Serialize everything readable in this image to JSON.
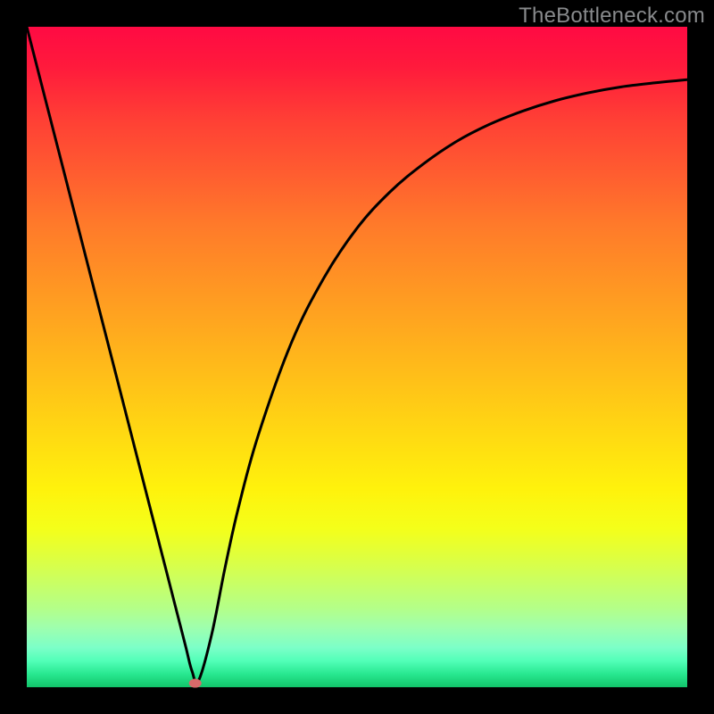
{
  "watermark": {
    "text": "TheBottleneck.com"
  },
  "chart_data": {
    "type": "line",
    "title": "",
    "xlabel": "",
    "ylabel": "",
    "xlim": [
      0,
      100
    ],
    "ylim": [
      0,
      100
    ],
    "grid": false,
    "series": [
      {
        "name": "bottleneck-curve",
        "x": [
          0,
          2,
          4,
          6,
          8,
          10,
          12,
          14,
          16,
          18,
          20,
          22,
          24,
          25,
          26,
          28,
          30,
          32,
          35,
          40,
          45,
          50,
          55,
          60,
          65,
          70,
          75,
          80,
          85,
          90,
          95,
          100
        ],
        "y": [
          100,
          92.2,
          84.4,
          76.6,
          68.8,
          61.0,
          53.2,
          45.4,
          37.6,
          29.8,
          22.0,
          14.2,
          6.4,
          2.5,
          1.0,
          8.0,
          18.0,
          27.0,
          38.0,
          52.0,
          62.0,
          69.5,
          75.0,
          79.2,
          82.6,
          85.2,
          87.2,
          88.8,
          90.0,
          90.9,
          91.5,
          92.0
        ]
      }
    ],
    "marker": {
      "x": 25.5,
      "y": 0.6,
      "color": "#d86a6a"
    },
    "background_gradient": {
      "top": "#ff0a43",
      "mid": "#ffe010",
      "bottom": "#12c46a"
    }
  }
}
